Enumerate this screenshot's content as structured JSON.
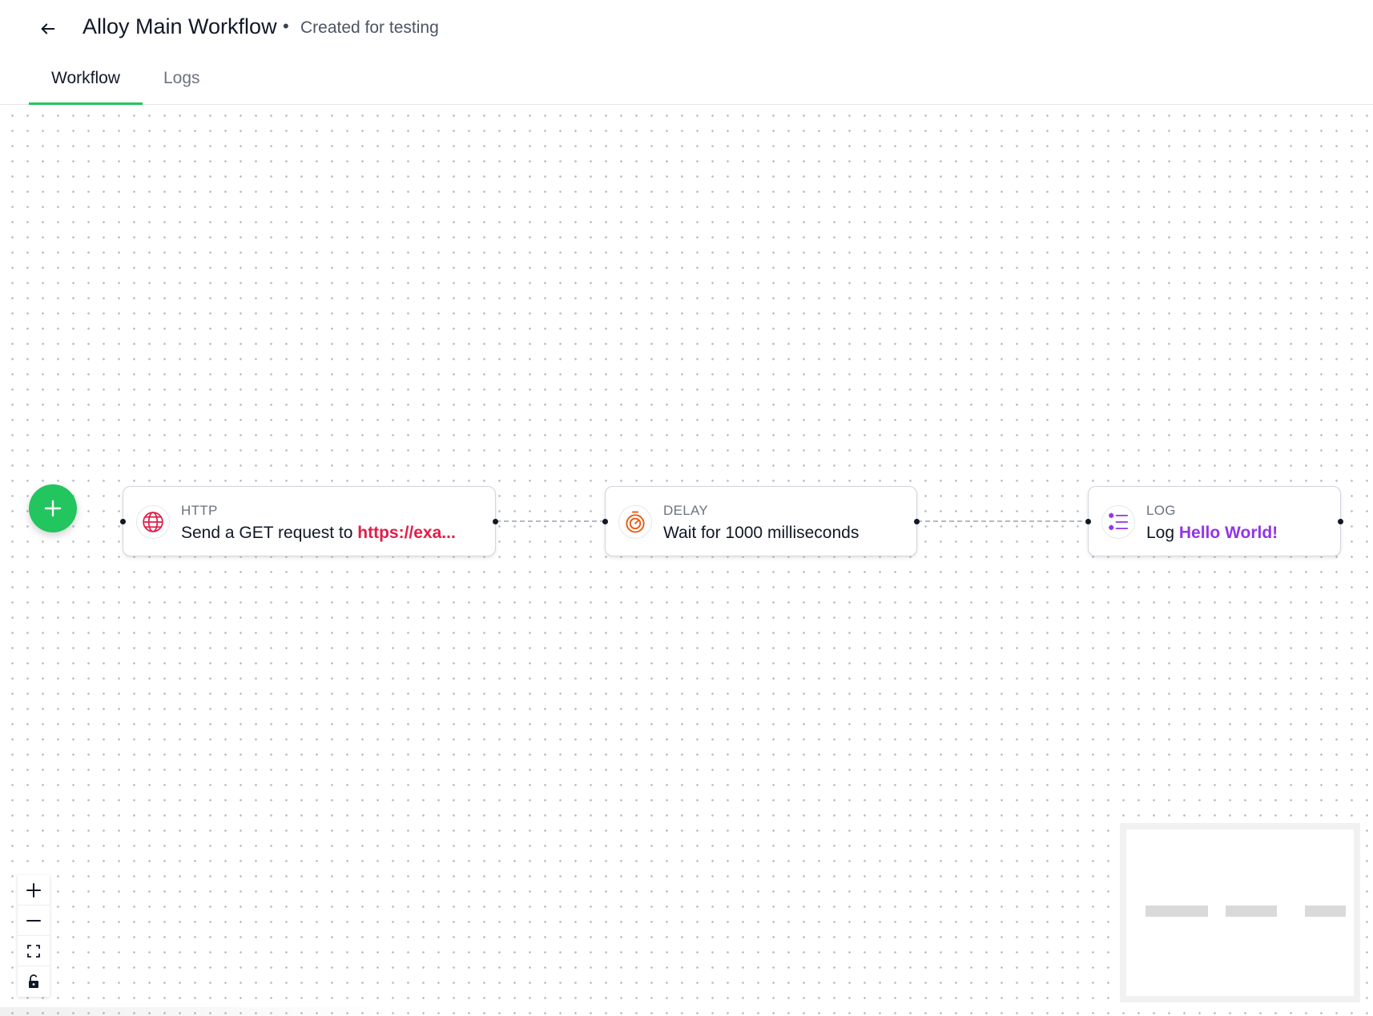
{
  "header": {
    "title": "Alloy Main Workflow",
    "separator": "•",
    "subtitle": "Created for testing"
  },
  "tabs": [
    {
      "label": "Workflow",
      "active": true
    },
    {
      "label": "Logs",
      "active": false
    }
  ],
  "nodes": [
    {
      "type": "HTTP",
      "icon": "globe-icon",
      "description_prefix": "Send a GET request to ",
      "description_highlight": "https://exa...",
      "highlight_color": "#e11d48"
    },
    {
      "type": "DELAY",
      "icon": "stopwatch-icon",
      "description_prefix": "Wait for 1000 milliseconds",
      "description_highlight": "",
      "highlight_color": "#ea580c"
    },
    {
      "type": "LOG",
      "icon": "list-icon",
      "description_prefix": "Log ",
      "description_highlight": "Hello World!",
      "highlight_color": "#9333ea"
    }
  ],
  "controls": [
    {
      "icon": "zoom-in-icon"
    },
    {
      "icon": "zoom-out-icon"
    },
    {
      "icon": "fit-view-icon"
    },
    {
      "icon": "lock-icon"
    }
  ],
  "colors": {
    "accent": "#22c55e",
    "http": "#e11d48",
    "delay": "#ea580c",
    "log": "#9333ea"
  }
}
